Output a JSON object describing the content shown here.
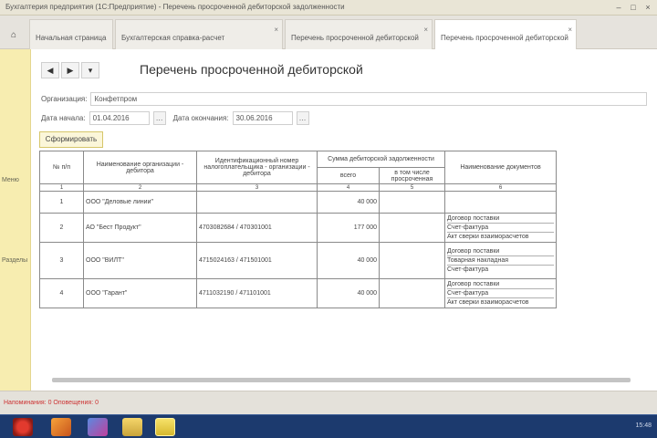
{
  "window": {
    "title": "Бухгалтерия предприятия (1С:Предприятие) - Перечень просроченной дебиторской задолженности"
  },
  "tabs": [
    {
      "label": "Начальная страница"
    },
    {
      "label": "Бухгалтерская справка-расчет"
    },
    {
      "label": "Перечень просроченной дебиторской"
    },
    {
      "label": "Перечень просроченной дебиторской"
    }
  ],
  "left_panel": {
    "items": [
      "Меню",
      "Разделы"
    ]
  },
  "toolbar": {
    "back_icon": "arrow-left-icon",
    "forward_icon": "arrow-right-icon",
    "menu_icon": "more-icon"
  },
  "document": {
    "title": "Перечень просроченной дебиторской"
  },
  "fields": {
    "org_label": "Организация:",
    "org_value": "Конфетпром",
    "date_start_label": "Дата начала:",
    "date_start_value": "01.04.2016",
    "date_end_label": "Дата окончания:",
    "date_end_value": "30.06.2016"
  },
  "buttons": {
    "form_label": "Сформировать"
  },
  "table": {
    "headers": {
      "num": "№ п/п",
      "name": "Наименование организации - дебитора",
      "inn": "Идентификационный номер налогоплательщика - организации - дебитора",
      "amount_group": "Сумма дебиторской задолженности",
      "amount_total": "всего",
      "amount_overdue": "в том числе просроченная",
      "docs": "Наименование документов"
    },
    "num_labels": [
      "1",
      "2",
      "3",
      "4",
      "5",
      "6"
    ],
    "rows": [
      {
        "num": "1",
        "name": "ООО \"Деловые линии\"",
        "inn": "",
        "total": "40 000",
        "overdue": "",
        "docs": []
      },
      {
        "num": "2",
        "name": "АО \"Бест Продукт\"",
        "inn": "4703082684 / 470301001",
        "total": "177 000",
        "overdue": "",
        "docs": [
          "Договор поставки",
          "Счет-фактура",
          "Акт сверки взаиморасчетов"
        ]
      },
      {
        "num": "3",
        "name": "ООО \"ВИЛТ\"",
        "inn": "4715024163 / 471501001",
        "total": "40 000",
        "overdue": "",
        "docs": [
          "Договор поставки",
          "Товарная накладная",
          "Счет-фактура"
        ]
      },
      {
        "num": "4",
        "name": "ООО \"Гарант\"",
        "inn": "4711032190 / 471101001",
        "total": "40 000",
        "overdue": "",
        "docs": [
          "Договор поставки",
          "Счет-фактура",
          "Акт сверки взаиморасчетов"
        ]
      }
    ]
  },
  "status": {
    "text": "Напоминания: 0  Оповещения: 0"
  },
  "taskbar": {
    "clock": "15:48"
  },
  "colors": {
    "left_panel": "#f7edb0",
    "taskbar": "#1c3a6e",
    "status_text": "#cc3333"
  }
}
